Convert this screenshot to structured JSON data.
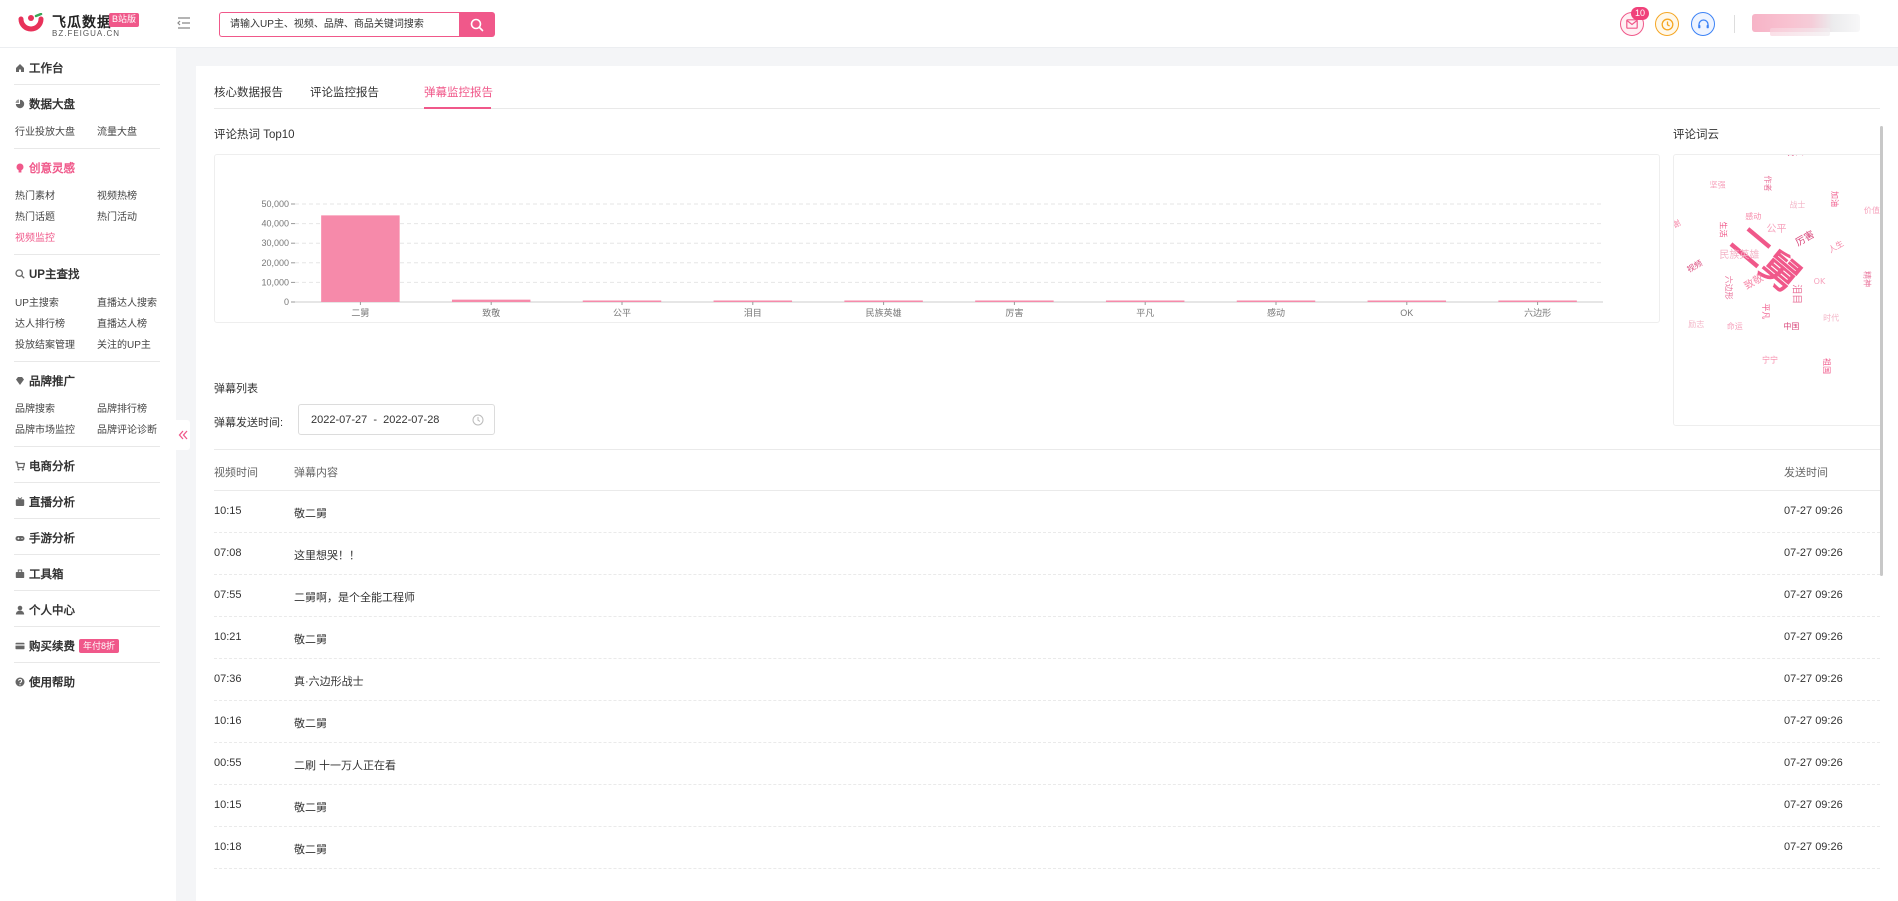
{
  "header": {
    "logo_title": "飞瓜数据",
    "logo_badge": "B站版",
    "logo_sub": "BZ.FEIGUA.CN",
    "search_placeholder": "请输入UP主、视频、品牌、商品关键词搜索",
    "mail_badge": "10"
  },
  "sidebar": {
    "groups": [
      {
        "label": "工作台",
        "icon": "home-icon",
        "items": []
      },
      {
        "label": "数据大盘",
        "icon": "pie-chart-icon",
        "items": [
          "行业投放大盘",
          "流量大盘"
        ]
      },
      {
        "label": "创意灵感",
        "icon": "bulb-icon",
        "active": true,
        "items": [
          "热门素材",
          "视频热榜",
          "热门话题",
          "热门活动",
          "视频监控"
        ]
      },
      {
        "label": "UP主查找",
        "icon": "search-icon",
        "items": [
          "UP主搜索",
          "直播达人搜索",
          "达人排行榜",
          "直播达人榜",
          "投放结案管理",
          "关注的UP主"
        ]
      },
      {
        "label": "品牌推广",
        "icon": "diamond-icon",
        "items": [
          "品牌搜索",
          "品牌排行榜",
          "品牌市场监控",
          "品牌评论诊断"
        ]
      },
      {
        "label": "电商分析",
        "icon": "cart-icon",
        "items": []
      },
      {
        "label": "直播分析",
        "icon": "tv-icon",
        "items": []
      },
      {
        "label": "手游分析",
        "icon": "gamepad-icon",
        "items": []
      },
      {
        "label": "工具箱",
        "icon": "toolbox-icon",
        "items": []
      },
      {
        "label": "个人中心",
        "icon": "user-icon",
        "items": []
      },
      {
        "label": "购买续费",
        "icon": "card-icon",
        "badge": "年付8折",
        "items": []
      },
      {
        "label": "使用帮助",
        "icon": "help-icon",
        "items": []
      }
    ],
    "active_sub": "视频监控"
  },
  "main": {
    "tabs": [
      "核心数据报告",
      "评论监控报告",
      "弹幕监控报告"
    ],
    "active_tab": "弹幕监控报告",
    "chart_title": "评论热词 Top10",
    "cloud_title": "评论词云",
    "list_title": "弹幕列表",
    "filter_label": "弹幕发送时间:",
    "date_range": "2022-07-27  -  2022-07-28",
    "table": {
      "headers": [
        "视频时间",
        "弹幕内容",
        "发送时间"
      ],
      "rows": [
        [
          "10:15",
          "敬二舅",
          "07-27 09:26"
        ],
        [
          "07:08",
          "这里想哭！！",
          "07-27 09:26"
        ],
        [
          "07:55",
          "二舅啊，是个全能工程师",
          "07-27 09:26"
        ],
        [
          "10:21",
          "敬二舅",
          "07-27 09:26"
        ],
        [
          "07:36",
          "真·六边形战士",
          "07-27 09:26"
        ],
        [
          "10:16",
          "敬二舅",
          "07-27 09:26"
        ],
        [
          "00:55",
          "二刷 十一万人正在看",
          "07-27 09:26"
        ],
        [
          "10:15",
          "敬二舅",
          "07-27 09:26"
        ],
        [
          "10:18",
          "敬二舅",
          "07-27 09:26"
        ]
      ]
    },
    "word_cloud": [
      "二舅",
      "致敬",
      "公平",
      "泪目",
      "民族英雄",
      "厉害",
      "平凡",
      "感动",
      "OK",
      "六边形",
      "战士",
      "中国",
      "生活",
      "人生",
      "命运",
      "作者",
      "时代",
      "视频",
      "加油",
      "宁宁",
      "坚强",
      "精神",
      "励志",
      "好人",
      "祖国",
      "感谢",
      "价值"
    ]
  },
  "chart_data": {
    "type": "bar",
    "categories": [
      "二舅",
      "致敬",
      "公平",
      "泪目",
      "民族英雄",
      "厉害",
      "平凡",
      "感动",
      "OK",
      "六边形"
    ],
    "values": [
      44200,
      1200,
      700,
      400,
      350,
      300,
      280,
      260,
      240,
      220
    ],
    "ylim": [
      0,
      50000
    ],
    "yticks": [
      "0",
      "10,000",
      "20,000",
      "30,000",
      "40,000",
      "50,000"
    ],
    "ytick_values": [
      0,
      10000,
      20000,
      30000,
      40000,
      50000
    ],
    "grid": true,
    "bar_color": "#f68aaa"
  },
  "colors": {
    "accent": "#f0588a",
    "bar": "#f68aaa"
  }
}
